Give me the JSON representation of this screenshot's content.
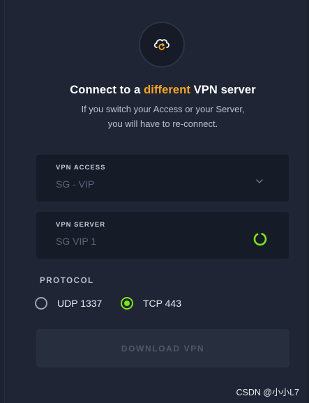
{
  "header": {
    "icon": "cloud-sync-icon",
    "title_prefix": "Connect to a ",
    "title_highlight": "different",
    "title_suffix": " VPN server",
    "subtitle_line1": "If you switch your Access or your Server,",
    "subtitle_line2": "you will have to re-connect."
  },
  "vpn_access": {
    "label": "VPN ACCESS",
    "value": "SG - VIP",
    "icon": "chevron-down-icon"
  },
  "vpn_server": {
    "label": "VPN SERVER",
    "value": "SG VIP 1",
    "icon": "loading-spinner-icon"
  },
  "protocol": {
    "label": "PROTOCOL",
    "options": [
      {
        "label": "UDP 1337",
        "selected": false
      },
      {
        "label": "TCP 443",
        "selected": true
      }
    ]
  },
  "download_button": {
    "label": "DOWNLOAD VPN",
    "enabled": false
  },
  "watermark": "CSDN @小小L7",
  "colors": {
    "accent_orange": "#f5a623",
    "accent_green": "#7fe316",
    "background": "#1f2535",
    "field_background": "#161b28"
  }
}
